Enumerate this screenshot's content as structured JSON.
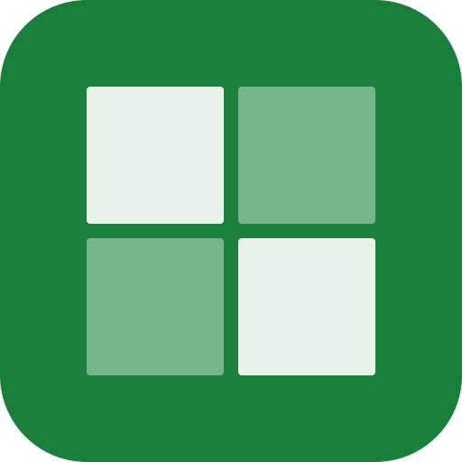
{
  "icon": {
    "name": "grid-app-icon",
    "colors": {
      "background": "#1a7f3a",
      "tile_light": "#e8f2ea",
      "tile_medium": "#77b58a"
    },
    "tiles": [
      {
        "name": "tile-top-left",
        "tone": "light"
      },
      {
        "name": "tile-top-right",
        "tone": "medium"
      },
      {
        "name": "tile-bottom-left",
        "tone": "medium"
      },
      {
        "name": "tile-bottom-right",
        "tone": "light"
      }
    ]
  }
}
